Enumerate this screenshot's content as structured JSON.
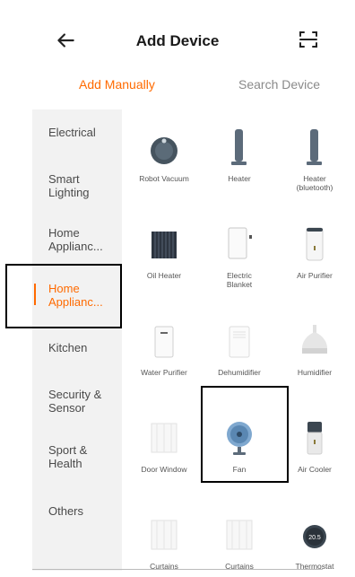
{
  "header": {
    "title": "Add Device",
    "back_icon": "arrow-left-icon",
    "scan_icon": "scan-icon"
  },
  "tabs": [
    {
      "label": "Add Manually",
      "active": true
    },
    {
      "label": "Search Device",
      "active": false
    }
  ],
  "colors": {
    "accent": "#ff6a00",
    "sidebar_bg": "#f2f2f2",
    "text": "#222222",
    "muted": "#8a8a8a"
  },
  "sidebar": {
    "items": [
      {
        "label": "Electrical"
      },
      {
        "label": "Smart\nLighting"
      },
      {
        "label": "Home\nApplianc..."
      },
      {
        "label": "Home\nApplianc...",
        "active": true
      },
      {
        "label": "Kitchen"
      },
      {
        "label": "Security &\nSensor"
      },
      {
        "label": "Sport &\nHealth"
      },
      {
        "label": "Others"
      }
    ]
  },
  "devices": [
    {
      "label": "Robot Vacuum",
      "icon": "robot-vacuum-icon"
    },
    {
      "label": "Heater",
      "icon": "heater-icon"
    },
    {
      "label": "Heater\n(bluetooth)",
      "icon": "heater-bluetooth-icon"
    },
    {
      "label": "Oil Heater",
      "icon": "oil-heater-icon"
    },
    {
      "label": "Electric\nBlanket",
      "icon": "electric-blanket-icon"
    },
    {
      "label": "Air Purifier",
      "icon": "air-purifier-icon"
    },
    {
      "label": "Water Purifier",
      "icon": "water-purifier-icon"
    },
    {
      "label": "Dehumidifier",
      "icon": "dehumidifier-icon"
    },
    {
      "label": "Humidifier",
      "icon": "humidifier-icon"
    },
    {
      "label": "Door Window",
      "icon": "door-window-icon"
    },
    {
      "label": "Fan",
      "icon": "fan-icon"
    },
    {
      "label": "Air Cooler",
      "icon": "air-cooler-icon"
    },
    {
      "label": "Curtains",
      "icon": "curtains-icon"
    },
    {
      "label": "Curtains",
      "icon": "curtains-icon"
    },
    {
      "label": "Thermostat",
      "icon": "thermostat-icon",
      "display": "20.5"
    }
  ]
}
